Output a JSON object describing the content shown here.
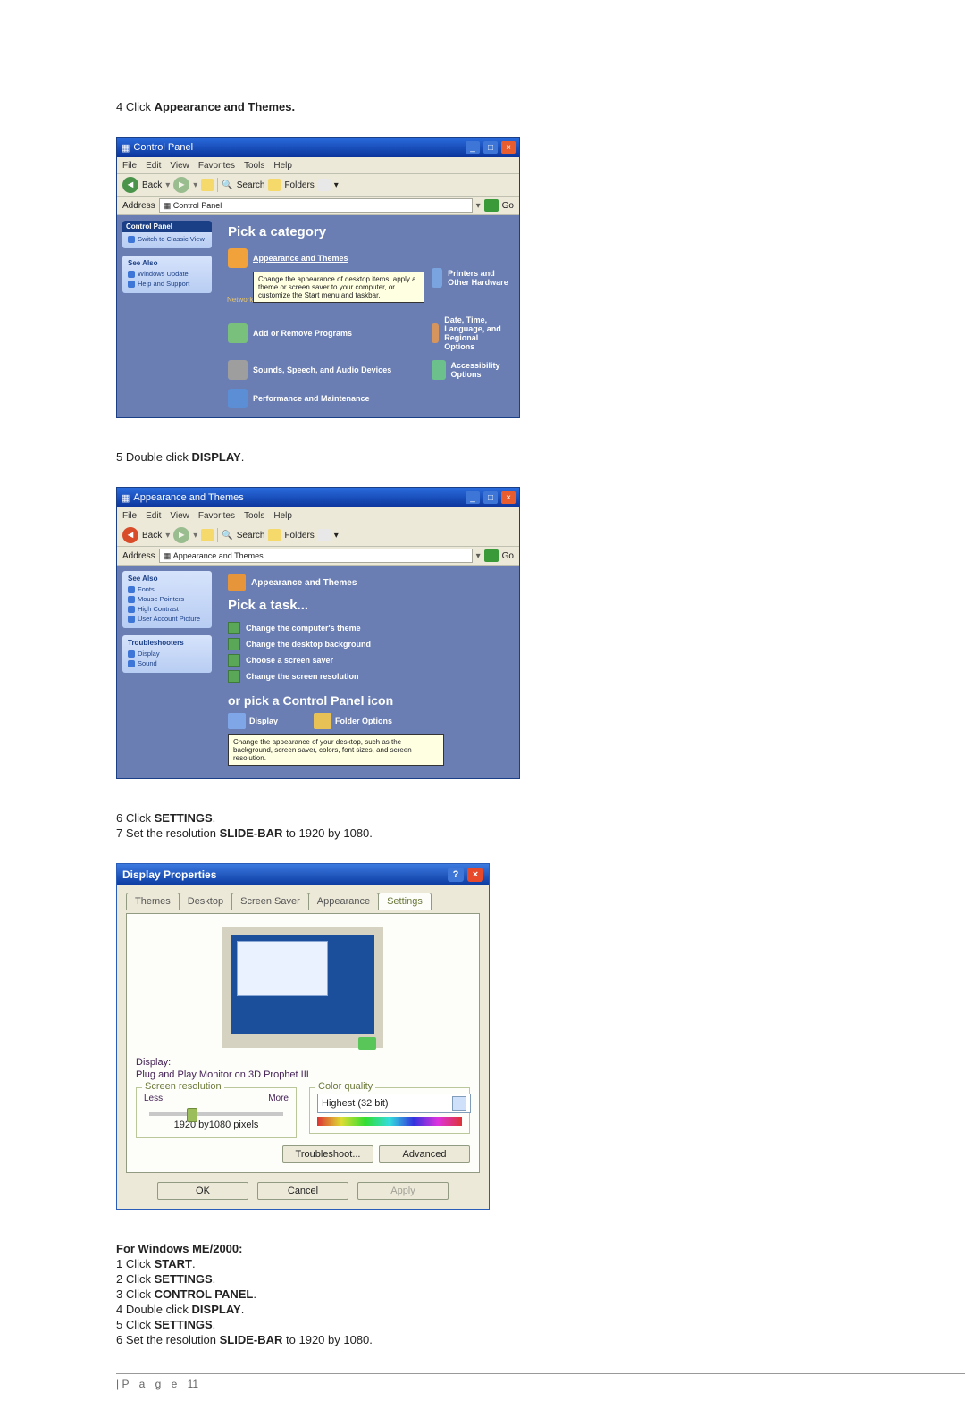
{
  "steps_a": {
    "s4_pre": "4 Click ",
    "s4_bold": "Appearance and Themes."
  },
  "cp1": {
    "title": "Control Panel",
    "menus": [
      "File",
      "Edit",
      "View",
      "Favorites",
      "Tools",
      "Help"
    ],
    "toolbar": {
      "back": "Back",
      "search": "Search",
      "folders": "Folders"
    },
    "address_label": "Address",
    "address_value": "Control Panel",
    "go": "Go",
    "side1_hd": "Control Panel",
    "side1_link": "Switch to Classic View",
    "side2_hd": "See Also",
    "side2_links": [
      "Windows Update",
      "Help and Support"
    ],
    "main_hd": "Pick a category",
    "cats": [
      "Appearance and Themes",
      "Printers and Other Hardware",
      "Add or Remove Programs",
      "Date, Time, Language, and Regional Options",
      "Sounds, Speech, and Audio Devices",
      "Accessibility Options",
      "Performance and Maintenance"
    ],
    "tooltip": "Change the appearance of desktop items, apply a theme or screen saver to your computer, or customize the Start menu and taskbar.",
    "tooltip_src": "Network"
  },
  "steps_b": {
    "s5_pre": "5 Double click ",
    "s5_bold": "DISPLAY",
    "s5_post": "."
  },
  "cp2": {
    "title": "Appearance and Themes",
    "menus": [
      "File",
      "Edit",
      "View",
      "Favorites",
      "Tools",
      "Help"
    ],
    "toolbar": {
      "back": "Back",
      "search": "Search",
      "folders": "Folders"
    },
    "address_label": "Address",
    "address_value": "Appearance and Themes",
    "go": "Go",
    "side1_hd": "See Also",
    "side1_links": [
      "Fonts",
      "Mouse Pointers",
      "High Contrast",
      "User Account Picture"
    ],
    "side2_hd": "Troubleshooters",
    "side2_links": [
      "Display",
      "Sound"
    ],
    "main_hd": "Pick a task...",
    "tasks": [
      "Change the computer's theme",
      "Change the desktop background",
      "Choose a screen saver",
      "Change the screen resolution"
    ],
    "or_hd": "or pick a Control Panel icon",
    "icons": [
      "Display",
      "Folder Options"
    ],
    "tooltip": "Change the appearance of your desktop, such as the background, screen saver, colors, font sizes, and screen resolution."
  },
  "steps_c": {
    "s6_pre": "6 Click ",
    "s6_bold": "SETTINGS",
    "s6_post": ".",
    "s7_pre": "7 Set the resolution ",
    "s7_bold": "SLIDE-BAR",
    "s7_post": " to 1920 by 1080."
  },
  "dp": {
    "title": "Display Properties",
    "tabs": [
      "Themes",
      "Desktop",
      "Screen Saver",
      "Appearance",
      "Settings"
    ],
    "display_lbl": "Display:",
    "display_val": "Plug and Play Monitor on 3D Prophet III",
    "res_grp": "Screen resolution",
    "res_less": "Less",
    "res_more": "More",
    "res_val": "1920 by1080 pixels",
    "cq_grp": "Color quality",
    "cq_val": "Highest (32 bit)",
    "btn_ts": "Troubleshoot...",
    "btn_adv": "Advanced",
    "btn_ok": "OK",
    "btn_cancel": "Cancel",
    "btn_apply": "Apply"
  },
  "me2000": {
    "hd": "For Windows ME/2000:",
    "lines": [
      {
        "pre": "1 Click ",
        "b": "START",
        "post": "."
      },
      {
        "pre": "2 Click ",
        "b": "SETTINGS",
        "post": "."
      },
      {
        "pre": "3 Click ",
        "b": "CONTROL PANEL",
        "post": "."
      },
      {
        "pre": "4 Double click ",
        "b": "DISPLAY",
        "post": "."
      },
      {
        "pre": "5 Click ",
        "b": "SETTINGS",
        "post": "."
      },
      {
        "pre": "6 Set the resolution ",
        "b": "SLIDE-BAR",
        "post": " to 1920 by 1080."
      }
    ]
  },
  "footer": {
    "page_label": "P a g e ",
    "page_num": "11"
  }
}
